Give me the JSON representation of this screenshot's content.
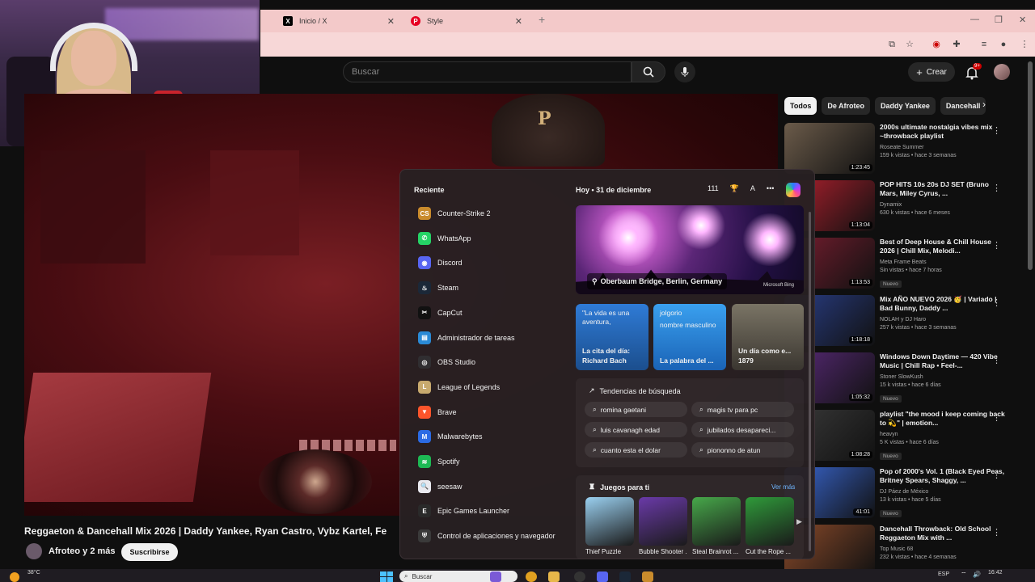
{
  "browser": {
    "tabs": [
      {
        "title": "Inicio / X",
        "favicon": "x-logo"
      },
      {
        "title": "Style",
        "favicon": "pinterest-logo"
      }
    ]
  },
  "youtube": {
    "search_placeholder": "Buscar",
    "create_label": "Crear",
    "notifications_badge": "9+",
    "video": {
      "title": "Reggaeton & Dancehall Mix 2026 | Daddy Yankee, Ryan Castro, Vybz Kartel, Fe",
      "channel": "Afroteo y 2 más",
      "subscribe_label": "Suscribirse"
    },
    "chips": [
      "Todos",
      "De Afroteo",
      "Daddy Yankee",
      "Dancehall"
    ],
    "recommendations": [
      {
        "title": "2000s ultimate nostalgia vibes mix ~throwback playlist",
        "channel": "Roseate Summer",
        "views": "159 k vistas • hace 3 semanas",
        "duration": "1:23:45",
        "badge": "",
        "thumb_color": "#6b5b4a"
      },
      {
        "title": "POP HITS 10s 20s DJ SET (Bruno Mars, Miley Cyrus, ...",
        "channel": "Dynamix",
        "views": "630 k vistas • hace 6 meses",
        "duration": "1:13:04",
        "badge": "",
        "thumb_color": "#b3202e"
      },
      {
        "title": "Best of Deep House & Chill House 2026 | Chill Mix, Melodi...",
        "channel": "Meta Frame Beats",
        "views": "Sin vistas • hace 7 horas",
        "duration": "1:13:53",
        "badge": "Nuevo",
        "thumb_color": "#7a1e30"
      },
      {
        "title": "Mix AÑO NUEVO 2026 🥳 | Variado | Bad Bunny, Daddy ...",
        "channel": "NOLAH y DJ Haro",
        "views": "257 k vistas • hace 3 semanas",
        "duration": "1:18:18",
        "badge": "",
        "thumb_color": "#2a3f8a"
      },
      {
        "title": "Windows Down Daytime — 420 Vibe Music | Chill Rap • Feel-...",
        "channel": "Stoner SlowKush",
        "views": "15 k vistas • hace 6 días",
        "duration": "1:05:32",
        "badge": "Nuevo",
        "thumb_color": "#5a2a7a"
      },
      {
        "title": "playlist \"the mood i keep coming back to 💫\" | emotion...",
        "channel": "heavyn",
        "views": "5 K vistas • hace 6 días",
        "duration": "1:08:28",
        "badge": "Nuevo",
        "thumb_color": "#3a3a3a"
      },
      {
        "title": "Pop of 2000's Vol. 1 (Black Eyed Peas, Britney Spears, Shaggy, ...",
        "channel": "DJ Páez de México",
        "views": "13 k vistas • hace 5 días",
        "duration": "41:01",
        "badge": "Nuevo",
        "thumb_color": "#3b6ad8"
      },
      {
        "title": "Dancehall Throwback: Old School Reggaeton Mix with ...",
        "channel": "Top Music 68",
        "views": "232 k vistas • hace 4 semanas",
        "duration": "",
        "badge": "",
        "thumb_color": "#8a4a2a"
      }
    ]
  },
  "start_menu": {
    "recent_title": "Reciente",
    "apps": [
      {
        "name": "Counter-Strike 2",
        "icon": "counter-strike-icon",
        "color": "#c98b2c",
        "glyph": "CS"
      },
      {
        "name": "WhatsApp",
        "icon": "whatsapp-icon",
        "color": "#25d366",
        "glyph": "✆"
      },
      {
        "name": "Discord",
        "icon": "discord-icon",
        "color": "#5865f2",
        "glyph": "◉"
      },
      {
        "name": "Steam",
        "icon": "steam-icon",
        "color": "#1b2838",
        "glyph": "♨"
      },
      {
        "name": "CapCut",
        "icon": "capcut-icon",
        "color": "#111111",
        "glyph": "✂"
      },
      {
        "name": "Administrador de tareas",
        "icon": "task-manager-icon",
        "color": "#2a8ad6",
        "glyph": "▤"
      },
      {
        "name": "OBS Studio",
        "icon": "obs-icon",
        "color": "#302e31",
        "glyph": "◎"
      },
      {
        "name": "League of Legends",
        "icon": "league-of-legends-icon",
        "color": "#c8aa6e",
        "glyph": "L"
      },
      {
        "name": "Brave",
        "icon": "brave-icon",
        "color": "#fb542b",
        "glyph": "▼"
      },
      {
        "name": "Malwarebytes",
        "icon": "malwarebytes-icon",
        "color": "#2b6be4",
        "glyph": "M"
      },
      {
        "name": "Spotify",
        "icon": "spotify-icon",
        "color": "#1db954",
        "glyph": "≋"
      },
      {
        "name": "seesaw",
        "icon": "seesaw-icon",
        "color": "#e9e9ef",
        "glyph": "🔍"
      },
      {
        "name": "Epic Games Launcher",
        "icon": "epic-games-icon",
        "color": "#2a2a2a",
        "glyph": "E"
      },
      {
        "name": "Control de aplicaciones y navegador",
        "icon": "security-shield-icon",
        "color": "#3a3a3a",
        "glyph": "⛨"
      }
    ],
    "today_label": "Hoy",
    "date": "31 de diciembre",
    "header_icons": [
      "111",
      "trophy",
      "A",
      "•••"
    ],
    "hero_location": "Oberbaum Bridge, Berlin, Germany",
    "hero_logo": "Microsoft Bing",
    "cards": [
      {
        "small": "\"La vida es una aventura,",
        "big": "La cita del día: Richard Bach"
      },
      {
        "small": "jolgorio",
        "small2": "nombre masculino",
        "big": "La palabra del ..."
      },
      {
        "small": "",
        "big": "Un día como e... 1879"
      }
    ],
    "trending_title": "Tendencias de búsqueda",
    "trending": [
      "romina gaetani",
      "magis tv para pc",
      "luis cavanagh edad",
      "jubilados desapareci...",
      "cuanto esta el dolar",
      "piononno de atun"
    ],
    "games_title": "Juegos para ti",
    "see_more": "Ver más",
    "games": [
      {
        "name": "Thief Puzzle",
        "color": "#9ad0f0"
      },
      {
        "name": "Bubble Shooter ...",
        "color": "#6a3aa8"
      },
      {
        "name": "Steal Brainrot ...",
        "color": "#47a84a"
      },
      {
        "name": "Cut the Rope ...",
        "color": "#2f9a3a"
      }
    ]
  },
  "taskbar": {
    "weather_temp": "38°C",
    "search_placeholder": "Buscar",
    "language": "ESP",
    "time": "16:42"
  }
}
